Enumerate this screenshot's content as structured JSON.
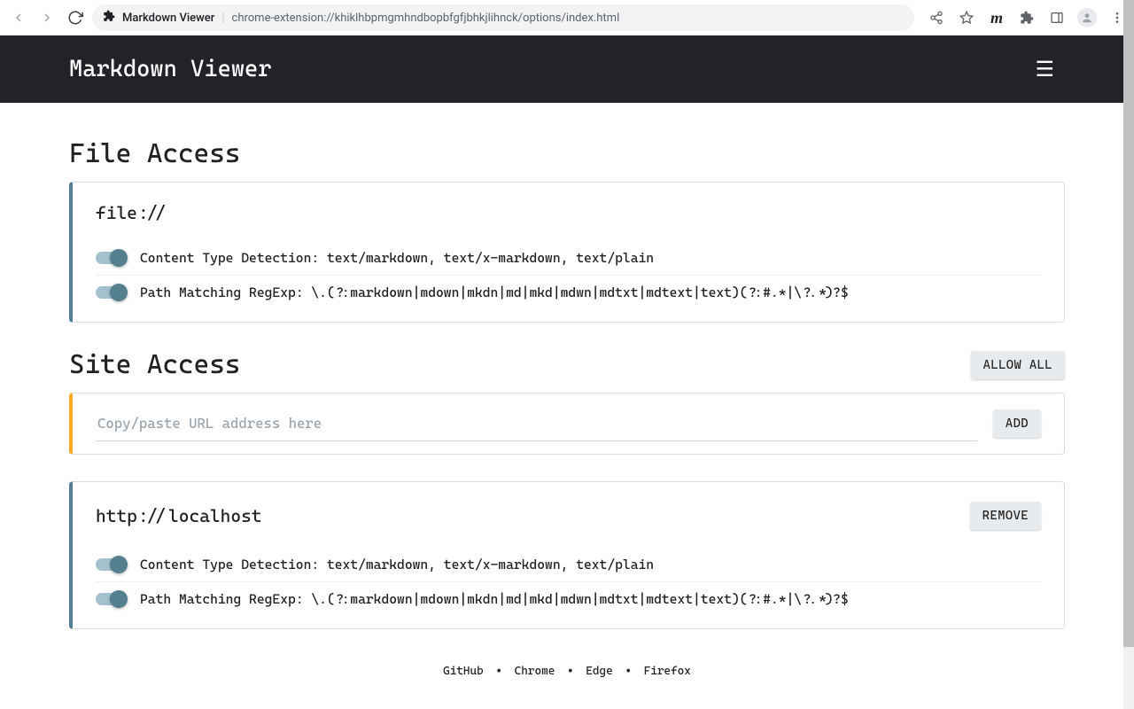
{
  "browser": {
    "page_title": "Markdown Viewer",
    "url": "chrome-extension://khiklhbpmgmhndbopbfgfjbhkjlihnck/options/index.html"
  },
  "header": {
    "title": "Markdown Viewer"
  },
  "file_access": {
    "heading": "File Access",
    "panel": {
      "title": "file://",
      "content_type": "Content Type Detection: text/markdown, text/x-markdown, text/plain",
      "path_match": "Path Matching RegExp: \\.(?:markdown|mdown|mkdn|md|mkd|mdwn|mdtxt|mdtext|text)(?:#.*|\\?.*)?$"
    }
  },
  "site_access": {
    "heading": "Site Access",
    "allow_all_label": "ALLOW ALL",
    "add_panel": {
      "placeholder": "Copy/paste URL address here",
      "add_label": "ADD"
    },
    "hosts": [
      {
        "title": "http://localhost",
        "remove_label": "REMOVE",
        "content_type": "Content Type Detection: text/markdown, text/x-markdown, text/plain",
        "path_match": "Path Matching RegExp: \\.(?:markdown|mdown|mkdn|md|mkd|mdwn|mdtxt|mdtext|text)(?:#.*|\\?.*)?$"
      }
    ]
  },
  "footer": {
    "github": "GitHub",
    "chrome": "Chrome",
    "edge": "Edge",
    "firefox": "Firefox"
  }
}
